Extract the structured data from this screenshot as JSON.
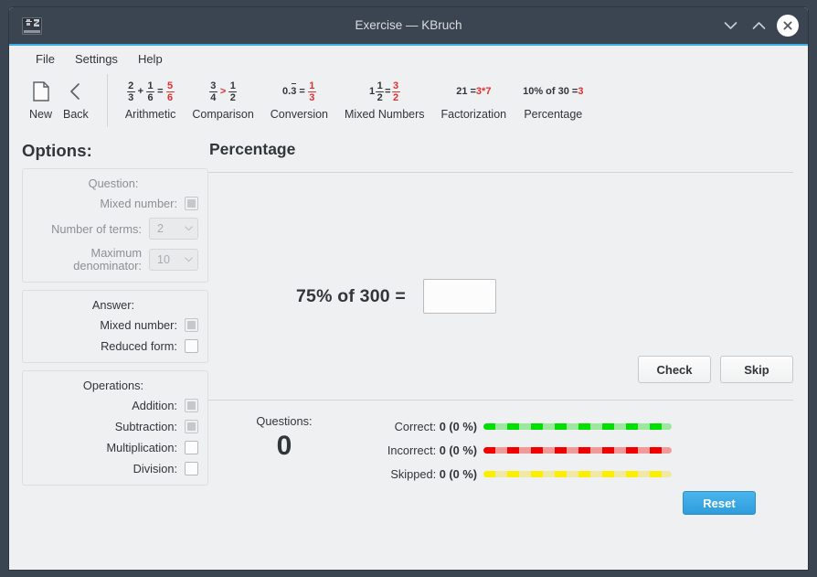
{
  "window": {
    "title": "Exercise — KBruch",
    "app_icon": "kbruch-fraction-icon",
    "buttons": {
      "minimize": "minimize-icon",
      "maximize": "maximize-icon",
      "close": "close-icon"
    }
  },
  "menubar": {
    "items": [
      "File",
      "Settings",
      "Help"
    ]
  },
  "toolbar": {
    "nav": [
      {
        "label": "New",
        "icon": "new-document-icon"
      },
      {
        "label": "Back",
        "icon": "chevron-left-icon"
      }
    ],
    "modes": [
      {
        "label": "Arithmetic",
        "icon": "arithmetic-icon",
        "expr": {
          "kind": "fraction-sum",
          "a_num": "2",
          "a_den": "3",
          "op": "+",
          "b_num": "1",
          "b_den": "6",
          "eq": "=",
          "r_num": "5",
          "r_den": "6"
        }
      },
      {
        "label": "Comparison",
        "icon": "comparison-icon",
        "expr": {
          "kind": "fraction-compare",
          "a_num": "3",
          "a_den": "4",
          "op": ">",
          "b_num": "1",
          "b_den": "2"
        }
      },
      {
        "label": "Conversion",
        "icon": "conversion-icon",
        "expr": {
          "kind": "decimal-to-fraction",
          "decimal": "0.3",
          "eq": "=",
          "r_num": "1",
          "r_den": "3"
        }
      },
      {
        "label": "Mixed Numbers",
        "icon": "mixed-numbers-icon",
        "expr": {
          "kind": "mixed-to-fraction",
          "whole": "1",
          "a_num": "1",
          "a_den": "2",
          "eq": "=",
          "r_num": "3",
          "r_den": "2"
        }
      },
      {
        "label": "Factorization",
        "icon": "factorization-icon",
        "expr": {
          "kind": "text",
          "left": "21 = ",
          "right": "3*7"
        }
      },
      {
        "label": "Percentage",
        "icon": "percentage-icon",
        "expr": {
          "kind": "text",
          "left": "10% of 30 = ",
          "right": "3"
        }
      }
    ]
  },
  "options": {
    "heading": "Options:",
    "question": {
      "title": "Question:",
      "mixed_number_label": "Mixed number:",
      "mixed_number_state": "checked-disabled",
      "number_of_terms_label": "Number of terms:",
      "number_of_terms_value": "2",
      "maximum_denominator_label_line1": "Maximum",
      "maximum_denominator_label_line2": "denominator:",
      "maximum_denominator_value": "10"
    },
    "answer": {
      "title": "Answer:",
      "mixed_number_label": "Mixed number:",
      "mixed_number_state": "checked-disabled",
      "reduced_form_label": "Reduced form:",
      "reduced_form_state": "unchecked"
    },
    "operations": {
      "title": "Operations:",
      "addition_label": "Addition:",
      "addition_state": "checked-disabled",
      "subtraction_label": "Subtraction:",
      "subtraction_state": "checked-disabled",
      "multiplication_label": "Multiplication:",
      "multiplication_state": "unchecked",
      "division_label": "Division:",
      "division_state": "unchecked"
    }
  },
  "main": {
    "page_title": "Percentage",
    "task": {
      "question_text": "75% of 300 =",
      "answer_value": "",
      "answer_placeholder": ""
    },
    "actions": {
      "check_label": "Check",
      "skip_label": "Skip"
    },
    "stats": {
      "questions_label": "Questions:",
      "questions_count": "0",
      "rows": [
        {
          "label": "Correct:",
          "value": "0 (0 %)",
          "color": "#00e000"
        },
        {
          "label": "Incorrect:",
          "value": "0 (0 %)",
          "color": "#f20000"
        },
        {
          "label": "Skipped:",
          "value": "0 (0 %)",
          "color": "#fbee00"
        }
      ],
      "reset_label": "Reset",
      "reset_color": "#3daee9"
    }
  }
}
